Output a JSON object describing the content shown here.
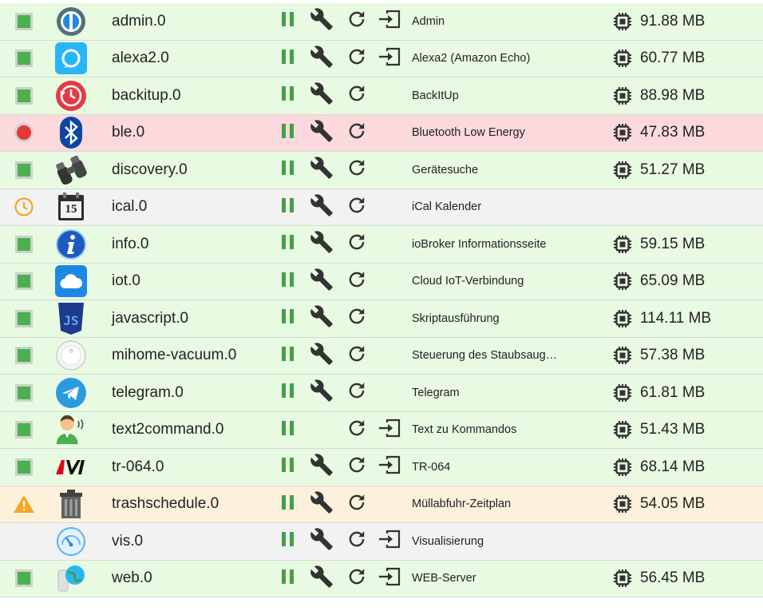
{
  "colors": {
    "running_green": "#4caf50",
    "pause_green": "#43a047",
    "error_red": "#e53935",
    "warning_orange": "#f5a623",
    "schedule_orange": "#f5a623",
    "icon_dark": "#333333",
    "row_green": "#e8fbe2",
    "row_red": "#fbd9dc",
    "row_grey": "#f2f2f2",
    "row_orange": "#fdf1dc"
  },
  "icons": {
    "pause": "pause-icon",
    "config": "wrench-icon",
    "restart": "restart-icon",
    "open": "open-in-icon",
    "memory": "chip-icon"
  },
  "instances": [
    {
      "name": "admin.0",
      "title": "Admin",
      "memory": "91.88 MB",
      "status": "running",
      "row": "green",
      "logo": "admin-logo-icon",
      "config": true,
      "open": true
    },
    {
      "name": "alexa2.0",
      "title": "Alexa2 (Amazon Echo)",
      "memory": "60.77 MB",
      "status": "running",
      "row": "green",
      "logo": "alexa-logo-icon",
      "config": true,
      "open": true
    },
    {
      "name": "backitup.0",
      "title": "BackItUp",
      "memory": "88.98 MB",
      "status": "running",
      "row": "green",
      "logo": "backitup-logo-icon",
      "config": true,
      "open": false
    },
    {
      "name": "ble.0",
      "title": "Bluetooth Low Energy",
      "memory": "47.83 MB",
      "status": "error",
      "row": "red",
      "logo": "bluetooth-logo-icon",
      "config": true,
      "open": false
    },
    {
      "name": "discovery.0",
      "title": "Gerätesuche",
      "memory": "51.27 MB",
      "status": "running",
      "row": "green",
      "logo": "binoculars-logo-icon",
      "config": true,
      "open": false
    },
    {
      "name": "ical.0",
      "title": "iCal Kalender",
      "memory": "",
      "status": "scheduled",
      "row": "grey",
      "logo": "calendar-logo-icon",
      "calendar_day": "15",
      "config": true,
      "open": false
    },
    {
      "name": "info.0",
      "title": "ioBroker Informationsseite",
      "memory": "59.15 MB",
      "status": "running",
      "row": "green",
      "logo": "info-logo-icon",
      "config": true,
      "open": false
    },
    {
      "name": "iot.0",
      "title": "Cloud IoT-Verbindung",
      "memory": "65.09 MB",
      "status": "running",
      "row": "green",
      "logo": "cloud-logo-icon",
      "config": true,
      "open": false
    },
    {
      "name": "javascript.0",
      "title": "Skriptausführung",
      "memory": "114.11 MB",
      "status": "running",
      "row": "green",
      "logo": "javascript-logo-icon",
      "logo_text": "JS",
      "config": true,
      "open": false
    },
    {
      "name": "mihome-vacuum.0",
      "title": "Steuerung des Staubsaug…",
      "memory": "57.38 MB",
      "status": "running",
      "row": "green",
      "logo": "vacuum-logo-icon",
      "config": true,
      "open": false
    },
    {
      "name": "telegram.0",
      "title": "Telegram",
      "memory": "61.81 MB",
      "status": "running",
      "row": "green",
      "logo": "telegram-logo-icon",
      "config": true,
      "open": false
    },
    {
      "name": "text2command.0",
      "title": "Text zu Kommandos",
      "memory": "51.43 MB",
      "status": "running",
      "row": "green",
      "logo": "speaker-person-logo-icon",
      "config": false,
      "open": true
    },
    {
      "name": "tr-064.0",
      "title": "TR-064",
      "memory": "68.14 MB",
      "status": "running",
      "row": "green",
      "logo": "avm-logo-icon",
      "config": true,
      "open": true
    },
    {
      "name": "trashschedule.0",
      "title": "Müllabfuhr-Zeitplan",
      "memory": "54.05 MB",
      "status": "warning",
      "row": "orange",
      "logo": "trash-can-logo-icon",
      "config": true,
      "open": false
    },
    {
      "name": "vis.0",
      "title": "Visualisierung",
      "memory": "",
      "status": "none",
      "row": "grey",
      "logo": "gauge-logo-icon",
      "config": true,
      "open": true
    },
    {
      "name": "web.0",
      "title": "WEB-Server",
      "memory": "56.45 MB",
      "status": "running",
      "row": "green",
      "logo": "web-globe-logo-icon",
      "config": true,
      "open": true
    }
  ]
}
